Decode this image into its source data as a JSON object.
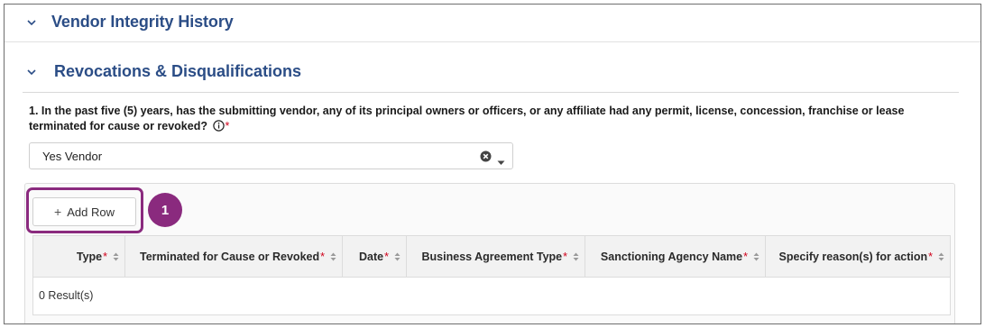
{
  "sections": {
    "vendor_integrity": {
      "title": "Vendor Integrity History"
    },
    "revocations": {
      "title": "Revocations & Disqualifications"
    }
  },
  "question": {
    "text": "1. In the past five (5) years, has the submitting vendor, any of its principal owners or officers, or any affiliate had any permit, license, concession, franchise or lease terminated for cause or revoked?",
    "required_marker": "*",
    "info_icon": "info-circle-icon"
  },
  "answer_select": {
    "value": "Yes Vendor",
    "clear_icon": "clear-circle-icon",
    "caret_icon": "caret-down-icon"
  },
  "add_row": {
    "label": "Add Row",
    "icon": "plus-icon"
  },
  "callout": {
    "number": "1",
    "color": "#8a2a7e"
  },
  "table": {
    "columns": [
      {
        "label": "Type",
        "required": "*"
      },
      {
        "label": "Terminated for Cause or Revoked",
        "required": "*"
      },
      {
        "label": "Date",
        "required": "*"
      },
      {
        "label": "Business Agreement Type",
        "required": "*"
      },
      {
        "label": "Sanctioning Agency Name",
        "required": "*"
      },
      {
        "label": "Specify reason(s) for action",
        "required": "*"
      }
    ],
    "results_text": "0 Result(s)"
  },
  "colors": {
    "heading": "#2b4d86",
    "required": "#d0021b",
    "callout": "#8a2a7e"
  }
}
